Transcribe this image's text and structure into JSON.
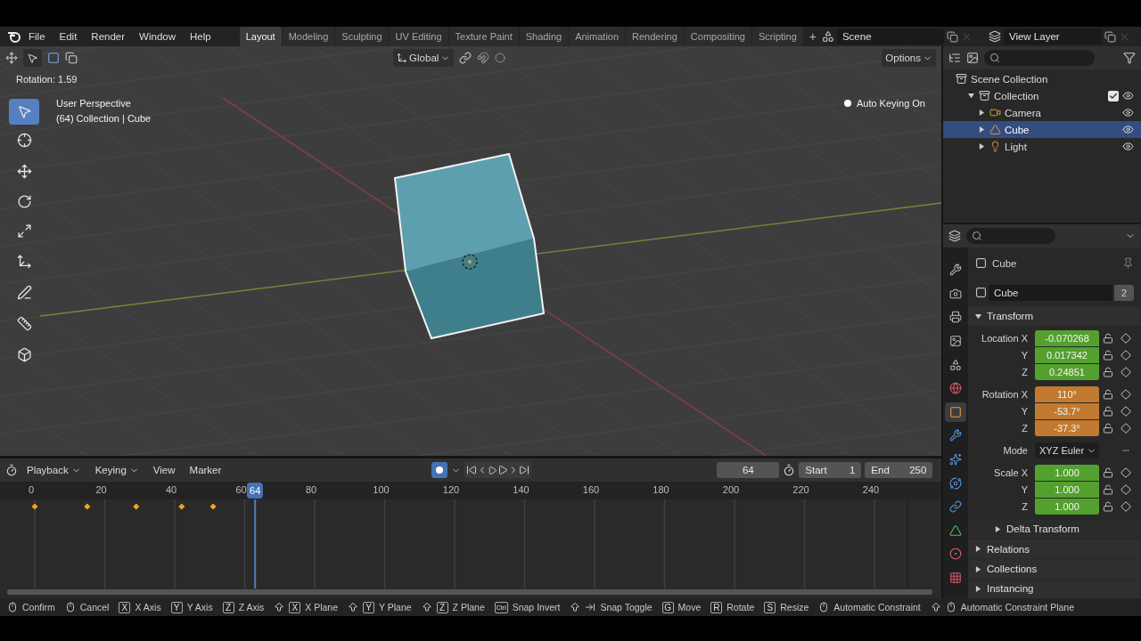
{
  "menu": [
    "File",
    "Edit",
    "Render",
    "Window",
    "Help"
  ],
  "workspaces": [
    {
      "label": "Layout",
      "selected": true
    },
    {
      "label": "Modeling",
      "selected": false
    },
    {
      "label": "Sculpting",
      "selected": false
    },
    {
      "label": "UV Editing",
      "selected": false
    },
    {
      "label": "Texture Paint",
      "selected": false
    },
    {
      "label": "Shading",
      "selected": false
    },
    {
      "label": "Animation",
      "selected": false
    },
    {
      "label": "Rendering",
      "selected": false
    },
    {
      "label": "Compositing",
      "selected": false
    },
    {
      "label": "Scripting",
      "selected": false
    }
  ],
  "add_workspace": "+",
  "scene": "Scene",
  "view_layer": "View Layer",
  "viewport": {
    "orientation": "Global",
    "options": "Options",
    "operator_info": "Rotation: 1.59",
    "view_name": "User Perspective",
    "object_info": "(64) Collection | Cube",
    "auto_keying": "Auto Keying On",
    "tools": [
      {
        "kind": "select",
        "selected": true
      },
      {
        "kind": "cursor",
        "selected": false
      },
      {
        "kind": "move",
        "selected": false
      },
      {
        "kind": "rotate",
        "selected": false
      },
      {
        "kind": "scale",
        "selected": false
      },
      {
        "kind": "transform",
        "selected": false
      },
      {
        "kind": "annotate",
        "selected": false
      },
      {
        "kind": "measure",
        "selected": false
      },
      {
        "kind": "add_cube",
        "selected": false
      }
    ]
  },
  "outliner": {
    "items": [
      {
        "label": "Scene Collection",
        "kind": "collection",
        "selected": false,
        "children": [
          {
            "label": "Collection",
            "kind": "collection",
            "selected": false,
            "expanded": true,
            "checked": true,
            "children": [
              {
                "label": "Camera",
                "kind": "camera",
                "selected": false,
                "expanded": false
              },
              {
                "label": "Cube",
                "kind": "mesh",
                "selected": true,
                "expanded": false
              },
              {
                "label": "Light",
                "kind": "light",
                "selected": false,
                "expanded": false
              }
            ]
          }
        ]
      }
    ]
  },
  "properties": {
    "tabs": [
      {
        "kind": "tool",
        "selected": false
      },
      {
        "kind": "render",
        "selected": false
      },
      {
        "kind": "output",
        "selected": false
      },
      {
        "kind": "view_layer",
        "selected": false
      },
      {
        "kind": "scene",
        "selected": false
      },
      {
        "kind": "world",
        "selected": false
      },
      {
        "kind": "object",
        "selected": true
      },
      {
        "kind": "modifiers",
        "selected": false
      },
      {
        "kind": "particles",
        "selected": false
      },
      {
        "kind": "physics",
        "selected": false
      },
      {
        "kind": "constraints",
        "selected": false
      },
      {
        "kind": "data",
        "selected": false
      },
      {
        "kind": "material",
        "selected": false
      },
      {
        "kind": "texture",
        "selected": false
      }
    ],
    "object_name": "Cube",
    "data_name": "Cube",
    "users": "2",
    "transform": {
      "title": "Transform",
      "expanded": true,
      "groups": [
        {
          "kind": "keyed",
          "rows": [
            {
              "label": "Location X",
              "value": "-0.070268"
            },
            {
              "label": "Y",
              "value": "0.017342"
            },
            {
              "label": "Z",
              "value": "0.24851"
            }
          ]
        },
        {
          "kind": "changed",
          "rows": [
            {
              "label": "Rotation X",
              "value": "110°"
            },
            {
              "label": "Y",
              "value": "-53.7°"
            },
            {
              "label": "Z",
              "value": "-37.3°"
            }
          ]
        },
        {
          "kind": "mode",
          "label": "Mode",
          "value": "XYZ Euler"
        },
        {
          "kind": "keyed",
          "rows": [
            {
              "label": "Scale X",
              "value": "1.000"
            },
            {
              "label": "Y",
              "value": "1.000"
            },
            {
              "label": "Z",
              "value": "1.000"
            }
          ]
        }
      ],
      "subpanel": {
        "label": "Delta Transform",
        "expanded": false
      }
    },
    "panels": [
      {
        "label": "Relations",
        "expanded": false
      },
      {
        "label": "Collections",
        "expanded": false
      },
      {
        "label": "Instancing",
        "expanded": false
      }
    ]
  },
  "timeline": {
    "menus": [
      {
        "label": "Playback",
        "dropdown": true
      },
      {
        "label": "Keying",
        "dropdown": true
      },
      {
        "label": "View",
        "dropdown": false
      },
      {
        "label": "Marker",
        "dropdown": false
      }
    ],
    "auto_key": true,
    "current_frame": "64",
    "start_label": "Start",
    "start": "1",
    "end_label": "End",
    "end": "250",
    "ticks": [
      "0",
      "20",
      "40",
      "60",
      "80",
      "100",
      "120",
      "140",
      "160",
      "180",
      "200",
      "220",
      "240"
    ],
    "playhead": "64"
  },
  "status_bar": [
    {
      "kind": "mouse",
      "label": "Confirm"
    },
    {
      "kind": "mouse",
      "label": "Cancel"
    },
    {
      "kind": "key",
      "key": "X",
      "label": "X Axis"
    },
    {
      "kind": "key",
      "key": "Y",
      "label": "Y Axis"
    },
    {
      "kind": "key",
      "key": "Z",
      "label": "Z Axis"
    },
    {
      "kind": "shift_key",
      "key": "X",
      "label": "X Plane"
    },
    {
      "kind": "shift_key",
      "key": "Y",
      "label": "Y Plane"
    },
    {
      "kind": "shift_key",
      "key": "Z",
      "label": "Z Plane"
    },
    {
      "kind": "key",
      "key": "Ctrl",
      "label": "Snap Invert"
    },
    {
      "kind": "shift_tab",
      "label": "Snap Toggle"
    },
    {
      "kind": "key",
      "key": "G",
      "label": "Move"
    },
    {
      "kind": "key",
      "key": "R",
      "label": "Rotate"
    },
    {
      "kind": "key",
      "key": "S",
      "label": "Resize"
    },
    {
      "kind": "mouse",
      "label": "Automatic Constraint"
    },
    {
      "kind": "shift_mouse",
      "label": "Automatic Constraint Plane"
    }
  ]
}
